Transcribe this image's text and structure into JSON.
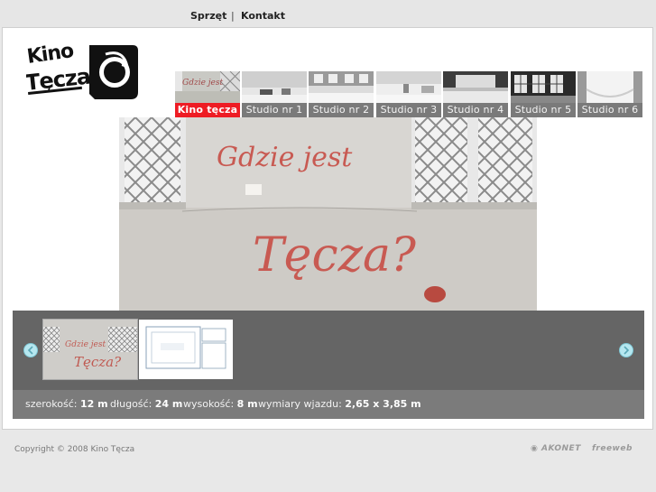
{
  "topnav": {
    "links": [
      "Sprzęt",
      "Kontakt"
    ],
    "separator": "|"
  },
  "logo": {
    "text": "Kino Tęcza"
  },
  "tabs": [
    {
      "label": "Kino tęcza",
      "active": true
    },
    {
      "label": "Studio nr 1"
    },
    {
      "label": "Studio nr 2"
    },
    {
      "label": "Studio nr 3"
    },
    {
      "label": "Studio nr 4"
    },
    {
      "label": "Studio nr 5"
    },
    {
      "label": "Studio nr 6"
    }
  ],
  "main_photo": {
    "graffiti_line1": "Gdzie jest",
    "graffiti_line2": "Tęcza?"
  },
  "gallery": {
    "thumbs": [
      "photo-thumb",
      "floorplan-thumb"
    ]
  },
  "dimensions": {
    "width_label": "szerokość:",
    "width_value": "12 m",
    "length_label": "długość:",
    "length_value": "24 m",
    "height_label": "wysokość:",
    "height_value": "8 m",
    "entry_label": "wymiary wjazdu:",
    "entry_value": "2,65 x 3,85 m"
  },
  "footer": {
    "copyright": "Copyright © 2008 Kino Tęcza",
    "partner1": "AKONET",
    "partner2": "freeweb"
  },
  "colors": {
    "accent": "#ee1c24",
    "strip": "#656565",
    "dims_bar": "#7b7b7b"
  }
}
